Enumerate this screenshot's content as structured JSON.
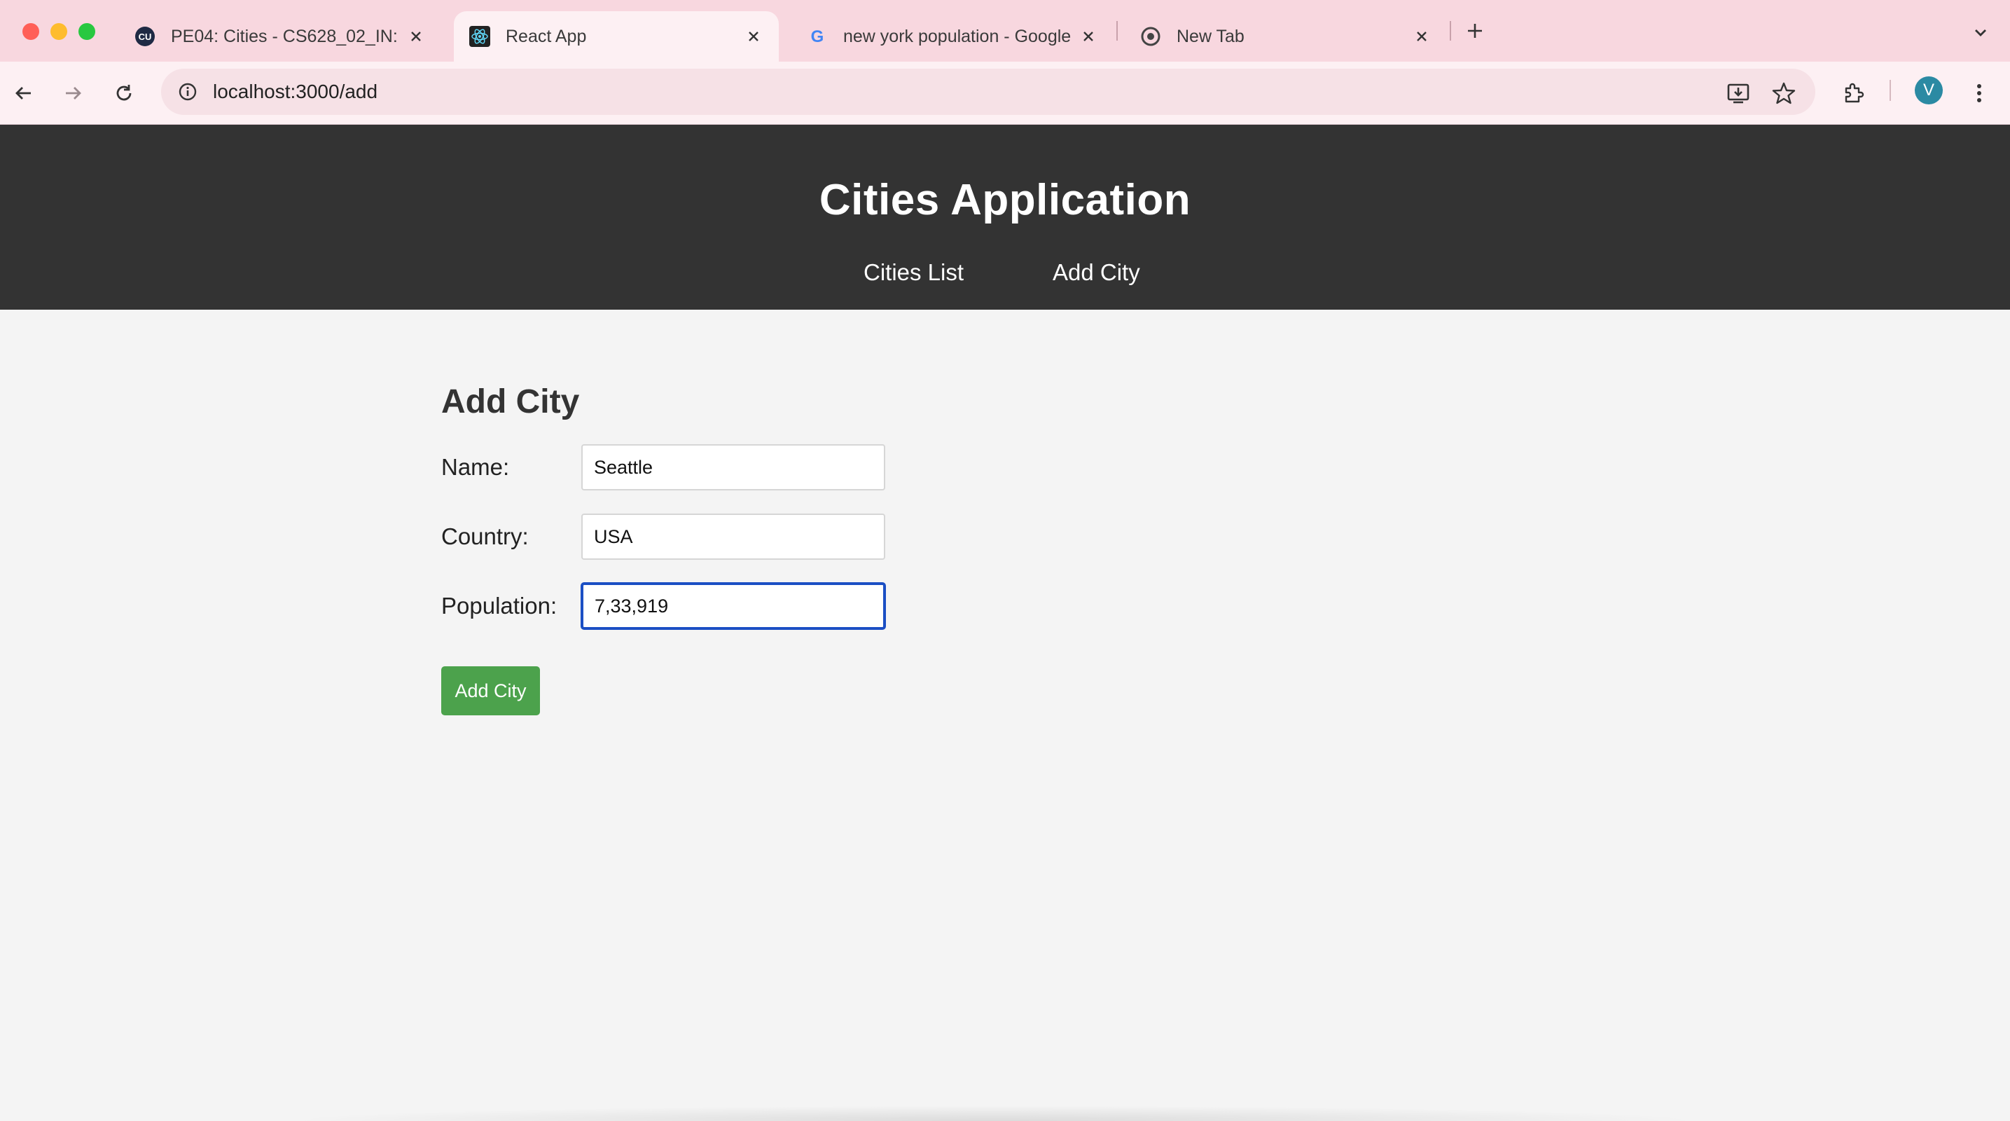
{
  "browser": {
    "tabs": [
      {
        "title": "PE04: Cities - CS628_02_IN:",
        "icon": "cu-icon",
        "active": false
      },
      {
        "title": "React App",
        "icon": "react-icon",
        "active": true
      },
      {
        "title": "new york population - Google",
        "icon": "google-icon",
        "active": false
      },
      {
        "title": "New Tab",
        "icon": "chrome-icon",
        "active": false
      }
    ],
    "url": "localhost:3000/add",
    "avatar_letter": "V",
    "colors": {
      "tabstrip": "#f8d7df",
      "toolbar": "#fdf0f3",
      "avatar": "#2b8aa3"
    }
  },
  "app": {
    "title": "Cities Application",
    "nav": {
      "cities_list": "Cities List",
      "add_city": "Add City"
    },
    "colors": {
      "header": "#333333",
      "background": "#f4f4f4",
      "button": "#4ca24c",
      "focus": "#1b4fc4"
    }
  },
  "form": {
    "heading": "Add City",
    "name_label": "Name:",
    "name_value": "Seattle",
    "country_label": "Country:",
    "country_value": "USA",
    "population_label": "Population:",
    "population_value": "7,33,919",
    "submit_label": "Add City"
  }
}
